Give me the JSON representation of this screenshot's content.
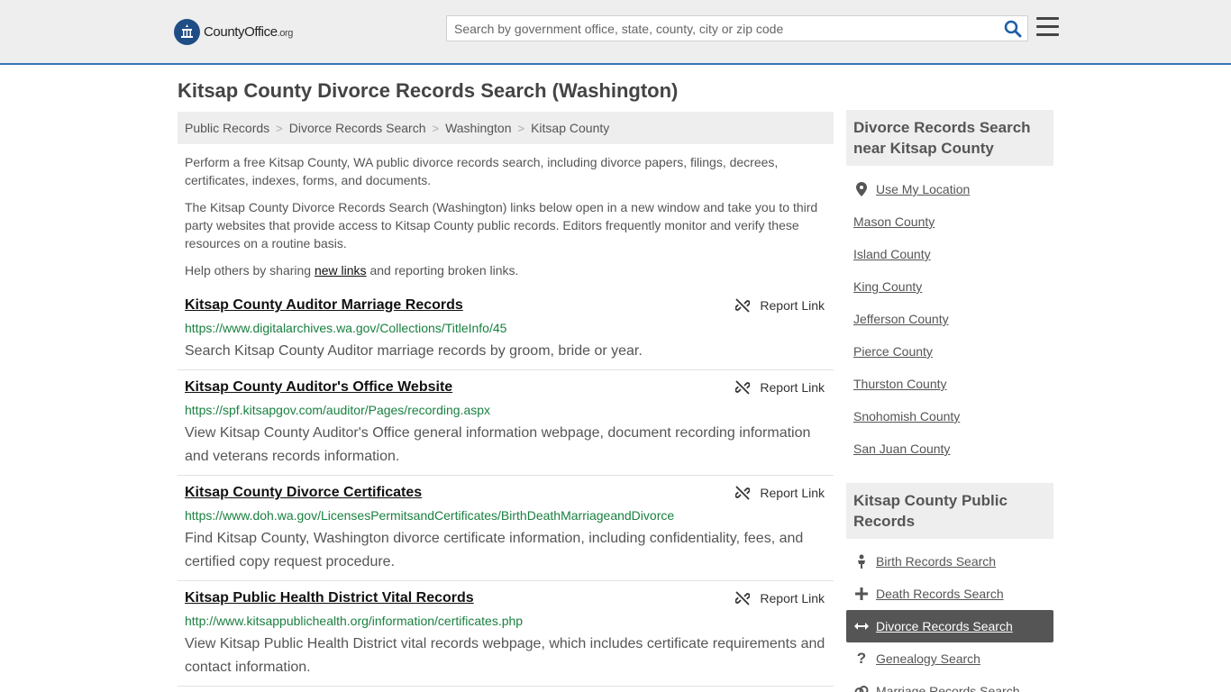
{
  "header": {
    "logo_main": "CountyOffice",
    "logo_tld": ".org",
    "search_placeholder": "Search by government office, state, county, city or zip code"
  },
  "page_title": "Kitsap County Divorce Records Search (Washington)",
  "breadcrumb": [
    "Public Records",
    "Divorce Records Search",
    "Washington",
    "Kitsap County"
  ],
  "intro": {
    "p1": "Perform a free Kitsap County, WA public divorce records search, including divorce papers, filings, decrees, certificates, indexes, forms, and documents.",
    "p2": "The Kitsap County Divorce Records Search (Washington) links below open in a new window and take you to third party websites that provide access to Kitsap County public records. Editors frequently monitor and verify these resources on a routine basis.",
    "p3_before": "Help others by sharing ",
    "p3_link": "new links",
    "p3_after": " and reporting broken links."
  },
  "report_label": "Report Link",
  "results": [
    {
      "title": "Kitsap County Auditor Marriage Records",
      "url": "https://www.digitalarchives.wa.gov/Collections/TitleInfo/45",
      "desc": "Search Kitsap County Auditor marriage records by groom, bride or year."
    },
    {
      "title": "Kitsap County Auditor's Office Website",
      "url": "https://spf.kitsapgov.com/auditor/Pages/recording.aspx",
      "desc": "View Kitsap County Auditor's Office general information webpage, document recording information and veterans records information."
    },
    {
      "title": "Kitsap County Divorce Certificates",
      "url": "https://www.doh.wa.gov/LicensesPermitsandCertificates/BirthDeathMarriageandDivorce",
      "desc": "Find Kitsap County, Washington divorce certificate information, including confidentiality, fees, and certified copy request procedure."
    },
    {
      "title": "Kitsap Public Health District Vital Records",
      "url": "http://www.kitsappublichealth.org/information/certificates.php",
      "desc": "View Kitsap Public Health District vital records webpage, which includes certificate requirements and contact information."
    }
  ],
  "sidebar": {
    "nearby_heading": "Divorce Records Search near Kitsap County",
    "use_location": "Use My Location",
    "nearby": [
      "Mason County",
      "Island County",
      "King County",
      "Jefferson County",
      "Pierce County",
      "Thurston County",
      "Snohomish County",
      "San Juan County"
    ],
    "public_heading": "Kitsap County Public Records",
    "public_records": [
      {
        "label": "Birth Records Search",
        "icon": "person-icon"
      },
      {
        "label": "Death Records Search",
        "icon": "cross-icon"
      },
      {
        "label": "Divorce Records Search",
        "icon": "arrows-icon",
        "active": true
      },
      {
        "label": "Genealogy Search",
        "icon": "question-icon"
      },
      {
        "label": "Marriage Records Search",
        "icon": "rings-icon"
      }
    ]
  }
}
